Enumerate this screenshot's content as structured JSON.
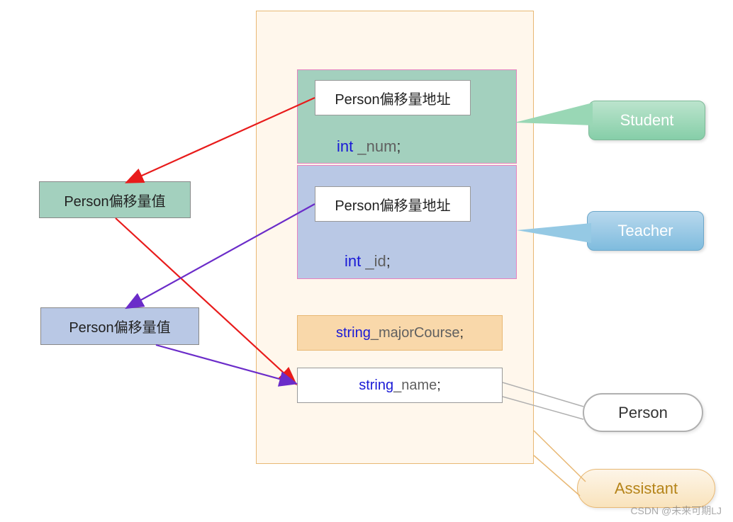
{
  "offset_green": "Person偏移量值",
  "offset_blue": "Person偏移量值",
  "student": {
    "addr": "Person偏移量地址",
    "num_type": "int",
    "num_var": " _num",
    "semi": ";"
  },
  "teacher": {
    "addr": "Person偏移量地址",
    "id_type": "int",
    "id_var": " _id",
    "semi": ";"
  },
  "majorcourse": {
    "type": "string",
    "var": " _majorCourse",
    "semi": ";"
  },
  "name": {
    "type": "string",
    "var": " _name",
    "semi": ";"
  },
  "callouts": {
    "student": "Student",
    "teacher": "Teacher",
    "person": "Person",
    "assistant": "Assistant"
  },
  "watermark": "CSDN @未来可期LJ"
}
